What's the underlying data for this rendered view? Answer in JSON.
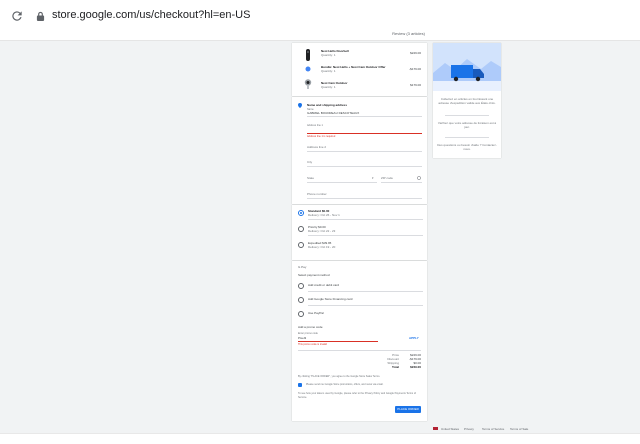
{
  "browser": {
    "url": "store.google.com/us/checkout?hl=en-US"
  },
  "review": {
    "label": "Review (3 articles)"
  },
  "order": {
    "items": [
      {
        "name": "Nest Hello Doorbell",
        "qty": "Quantity: 1",
        "price": "$229.00"
      },
      {
        "name": "Bundle: Nest Hello + Nest Cam Outdoor Offer",
        "qty": "Quantity: 1",
        "price": "-$179.00"
      },
      {
        "name": "Nest Cam Outdoor",
        "qty": "Quantity: 1",
        "price": "$179.00"
      }
    ]
  },
  "shipping": {
    "title": "Name and shipping address",
    "name_label": "Name",
    "name_value": "GABRIEL BOUDREAU DESCOTEAUX",
    "address1_label": "Address line 1",
    "address1_error": "Address line 1 is required",
    "address2_label": "Address line 2",
    "city_label": "City",
    "state_label": "State",
    "zip_label": "ZIP code",
    "phone_label": "Phone number"
  },
  "delivery": {
    "options": [
      {
        "name": "Standard $0.00",
        "detail": "Delivery: Oct 26 - Nov 1"
      },
      {
        "name": "Priority $0.00",
        "detail": "Delivery: Oct 22 - 23"
      },
      {
        "name": "Expedited $39.95",
        "detail": "Delivery: Oct 19 - 20"
      }
    ]
  },
  "payment": {
    "gpay_label": "G Pay",
    "select_label": "Select payment method",
    "options": [
      {
        "label": "Add credit or debit card"
      },
      {
        "label": "Add Google Store Financing card"
      },
      {
        "label": "Use PayPal"
      }
    ],
    "promo_label": "Add a promo code",
    "promo_field_label": "Enter promo code",
    "promo_value": "Pixel3",
    "apply_label": "APPLY",
    "promo_error": "This promo code is invalid"
  },
  "totals": {
    "rows": [
      {
        "label": "Price",
        "value": "$229.00"
      },
      {
        "label": "Discount",
        "value": "-$179.00"
      },
      {
        "label": "Shipping",
        "value": "$0.00"
      },
      {
        "label": "Total",
        "value": "$229.00"
      }
    ]
  },
  "legal": {
    "terms": "By clicking \"PLACE ORDER\", you agree to the Google Store Sales Terms.",
    "marketing": "Please send me Google Store promotions, offers, and news via email.",
    "privacy": "To see how your data is used by Google, please refer to the Privacy Policy and Google Payments Terms of Service."
  },
  "place_order_label": "PLACE ORDER",
  "sidebar": {
    "text1": "Collectez en articles en fournissant une adresse d'expédition valide aux États-Unis.",
    "text2": "Vérifiez que votre adresse de livraison est à jour.",
    "text3": "Des questions ou besoin d'aide ? Contactez-nous."
  },
  "footer": {
    "country": "United States",
    "links": [
      "Privacy",
      "Terms of Service",
      "Terms of Sale"
    ]
  }
}
